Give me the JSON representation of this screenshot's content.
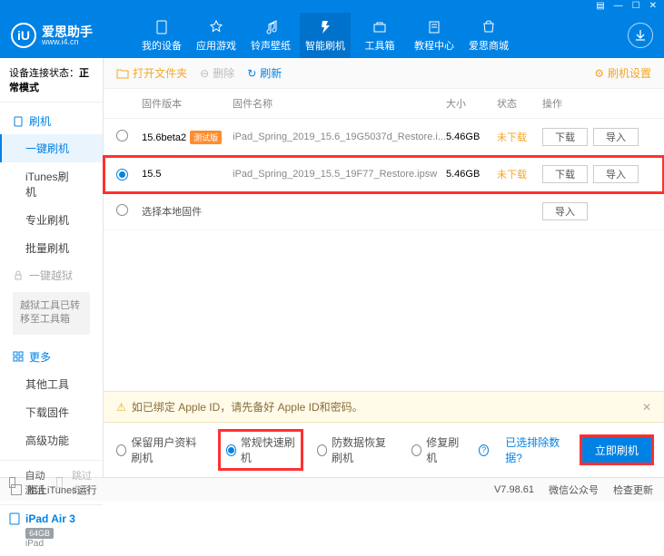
{
  "titlebar": {
    "icons": [
      "menu-icon",
      "minimize-icon",
      "maximize-icon",
      "close-icon"
    ]
  },
  "brand": {
    "logo": "iU",
    "name": "爱思助手",
    "url": "www.i4.cn"
  },
  "nav": [
    {
      "id": "my-device",
      "label": "我的设备"
    },
    {
      "id": "app-games",
      "label": "应用游戏"
    },
    {
      "id": "ring-wall",
      "label": "铃声壁纸"
    },
    {
      "id": "smart-flash",
      "label": "智能刷机",
      "active": true
    },
    {
      "id": "toolbox",
      "label": "工具箱"
    },
    {
      "id": "tutorial",
      "label": "教程中心"
    },
    {
      "id": "store",
      "label": "爱思商城"
    }
  ],
  "sidebar": {
    "conn_label": "设备连接状态：",
    "conn_mode": "正常模式",
    "group_flash": "刷机",
    "items_flash": [
      {
        "id": "one-key",
        "label": "一键刷机",
        "active": true
      },
      {
        "id": "itunes",
        "label": "iTunes刷机"
      },
      {
        "id": "pro",
        "label": "专业刷机"
      },
      {
        "id": "batch",
        "label": "批量刷机"
      }
    ],
    "group_jailbreak": "一键越狱",
    "jailbreak_note": "越狱工具已转移至工具箱",
    "group_more": "更多",
    "items_more": [
      {
        "id": "other-tools",
        "label": "其他工具"
      },
      {
        "id": "dl-firmware",
        "label": "下载固件"
      },
      {
        "id": "advanced",
        "label": "高级功能"
      }
    ],
    "auto_activate": "自动激活",
    "skip_guide": "跳过向导",
    "device": {
      "name": "iPad Air 3",
      "size": "64GB",
      "model": "iPad"
    }
  },
  "toolbar": {
    "open": "打开文件夹",
    "delete": "删除",
    "refresh": "刷新",
    "settings": "刷机设置"
  },
  "thead": {
    "ver": "固件版本",
    "name": "固件名称",
    "size": "大小",
    "status": "状态",
    "ops": "操作"
  },
  "firmwares": [
    {
      "sel": false,
      "ver": "15.6beta2",
      "badge": "测试版",
      "name": "iPad_Spring_2019_15.6_19G5037d_Restore.i...",
      "size": "5.46GB",
      "status": "未下载",
      "dl": "下载",
      "imp": "导入"
    },
    {
      "sel": true,
      "ver": "15.5",
      "badge": "",
      "name": "iPad_Spring_2019_15.5_19F77_Restore.ipsw",
      "size": "5.46GB",
      "status": "未下载",
      "dl": "下载",
      "imp": "导入"
    }
  ],
  "local_choice": {
    "label": "选择本地固件",
    "imp": "导入"
  },
  "warn": "如已绑定 Apple ID，请先备好 Apple ID和密码。",
  "flash_opts": [
    {
      "id": "keep-data",
      "label": "保留用户资料刷机"
    },
    {
      "id": "normal-fast",
      "label": "常规快速刷机",
      "sel": true,
      "hl": true
    },
    {
      "id": "recover",
      "label": "防数据恢复刷机"
    },
    {
      "id": "repair",
      "label": "修复刷机"
    }
  ],
  "exclude_link": "已选排除数据?",
  "flash_btn": "立即刷机",
  "footer": {
    "block": "阻止iTunes运行",
    "ver": "V7.98.61",
    "wechat": "微信公众号",
    "update": "检查更新"
  }
}
